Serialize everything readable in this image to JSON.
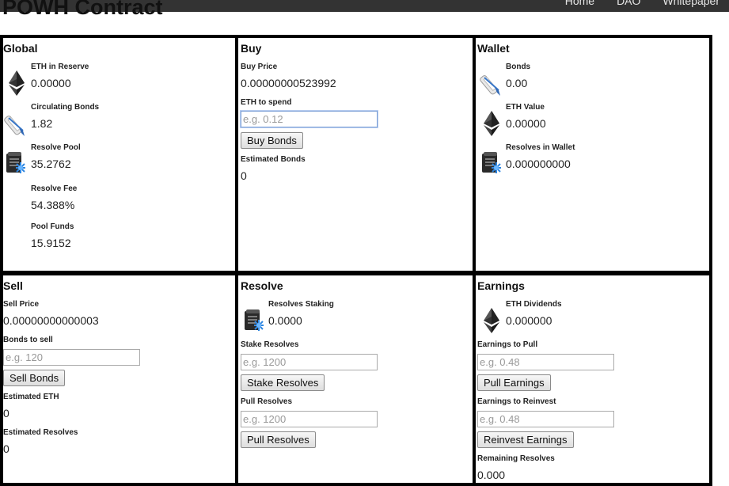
{
  "header": {
    "title": "POWH Contract",
    "nav": [
      "Home",
      "DAO",
      "Whitepaper"
    ]
  },
  "global": {
    "title": "Global",
    "eth_reserve_label": "ETH in Reserve",
    "eth_reserve_value": "0.00000",
    "circ_bonds_label": "Circulating Bonds",
    "circ_bonds_value": "1.82",
    "resolve_pool_label": "Resolve Pool",
    "resolve_pool_value": "35.2762",
    "resolve_fee_label": "Resolve Fee",
    "resolve_fee_value": "54.388%",
    "pool_funds_label": "Pool Funds",
    "pool_funds_value": "15.9152"
  },
  "buy": {
    "title": "Buy",
    "price_label": "Buy Price",
    "price_value": "0.00000000523992",
    "eth_label": "ETH to spend",
    "eth_placeholder": "e.g. 0.12",
    "button": "Buy Bonds",
    "est_label": "Estimated Bonds",
    "est_value": "0"
  },
  "wallet": {
    "title": "Wallet",
    "bonds_label": "Bonds",
    "bonds_value": "0.00",
    "eth_value_label": "ETH Value",
    "eth_value_value": "0.00000",
    "resolves_label": "Resolves in Wallet",
    "resolves_value": "0.000000000"
  },
  "sell": {
    "title": "Sell",
    "price_label": "Sell Price",
    "price_value": "0.00000000000003",
    "bonds_label": "Bonds to sell",
    "bonds_placeholder": "e.g. 120",
    "button": "Sell Bonds",
    "est_eth_label": "Estimated ETH",
    "est_eth_value": "0",
    "est_res_label": "Estimated Resolves",
    "est_res_value": "0"
  },
  "resolve": {
    "title": "Resolve",
    "staking_label": "Resolves Staking",
    "staking_value": "0.0000",
    "stake_label": "Stake Resolves",
    "stake_placeholder": "e.g. 1200",
    "stake_button": "Stake Resolves",
    "pull_label": "Pull Resolves",
    "pull_placeholder": "e.g. 1200",
    "pull_button": "Pull Resolves"
  },
  "earnings": {
    "title": "Earnings",
    "div_label": "ETH Dividends",
    "div_value": "0.000000",
    "pull_label": "Earnings to Pull",
    "pull_placeholder": "e.g. 0.48",
    "pull_button": "Pull Earnings",
    "reinvest_label": "Earnings to Reinvest",
    "reinvest_placeholder": "e.g. 0.48",
    "reinvest_button": "Reinvest Earnings",
    "remaining_label": "Remaining Resolves",
    "remaining_value": "0.000"
  },
  "icons": {
    "eth": "ethereum-icon",
    "bond": "diploma-scroll-icon",
    "resolve": "scroll-document-icon"
  }
}
